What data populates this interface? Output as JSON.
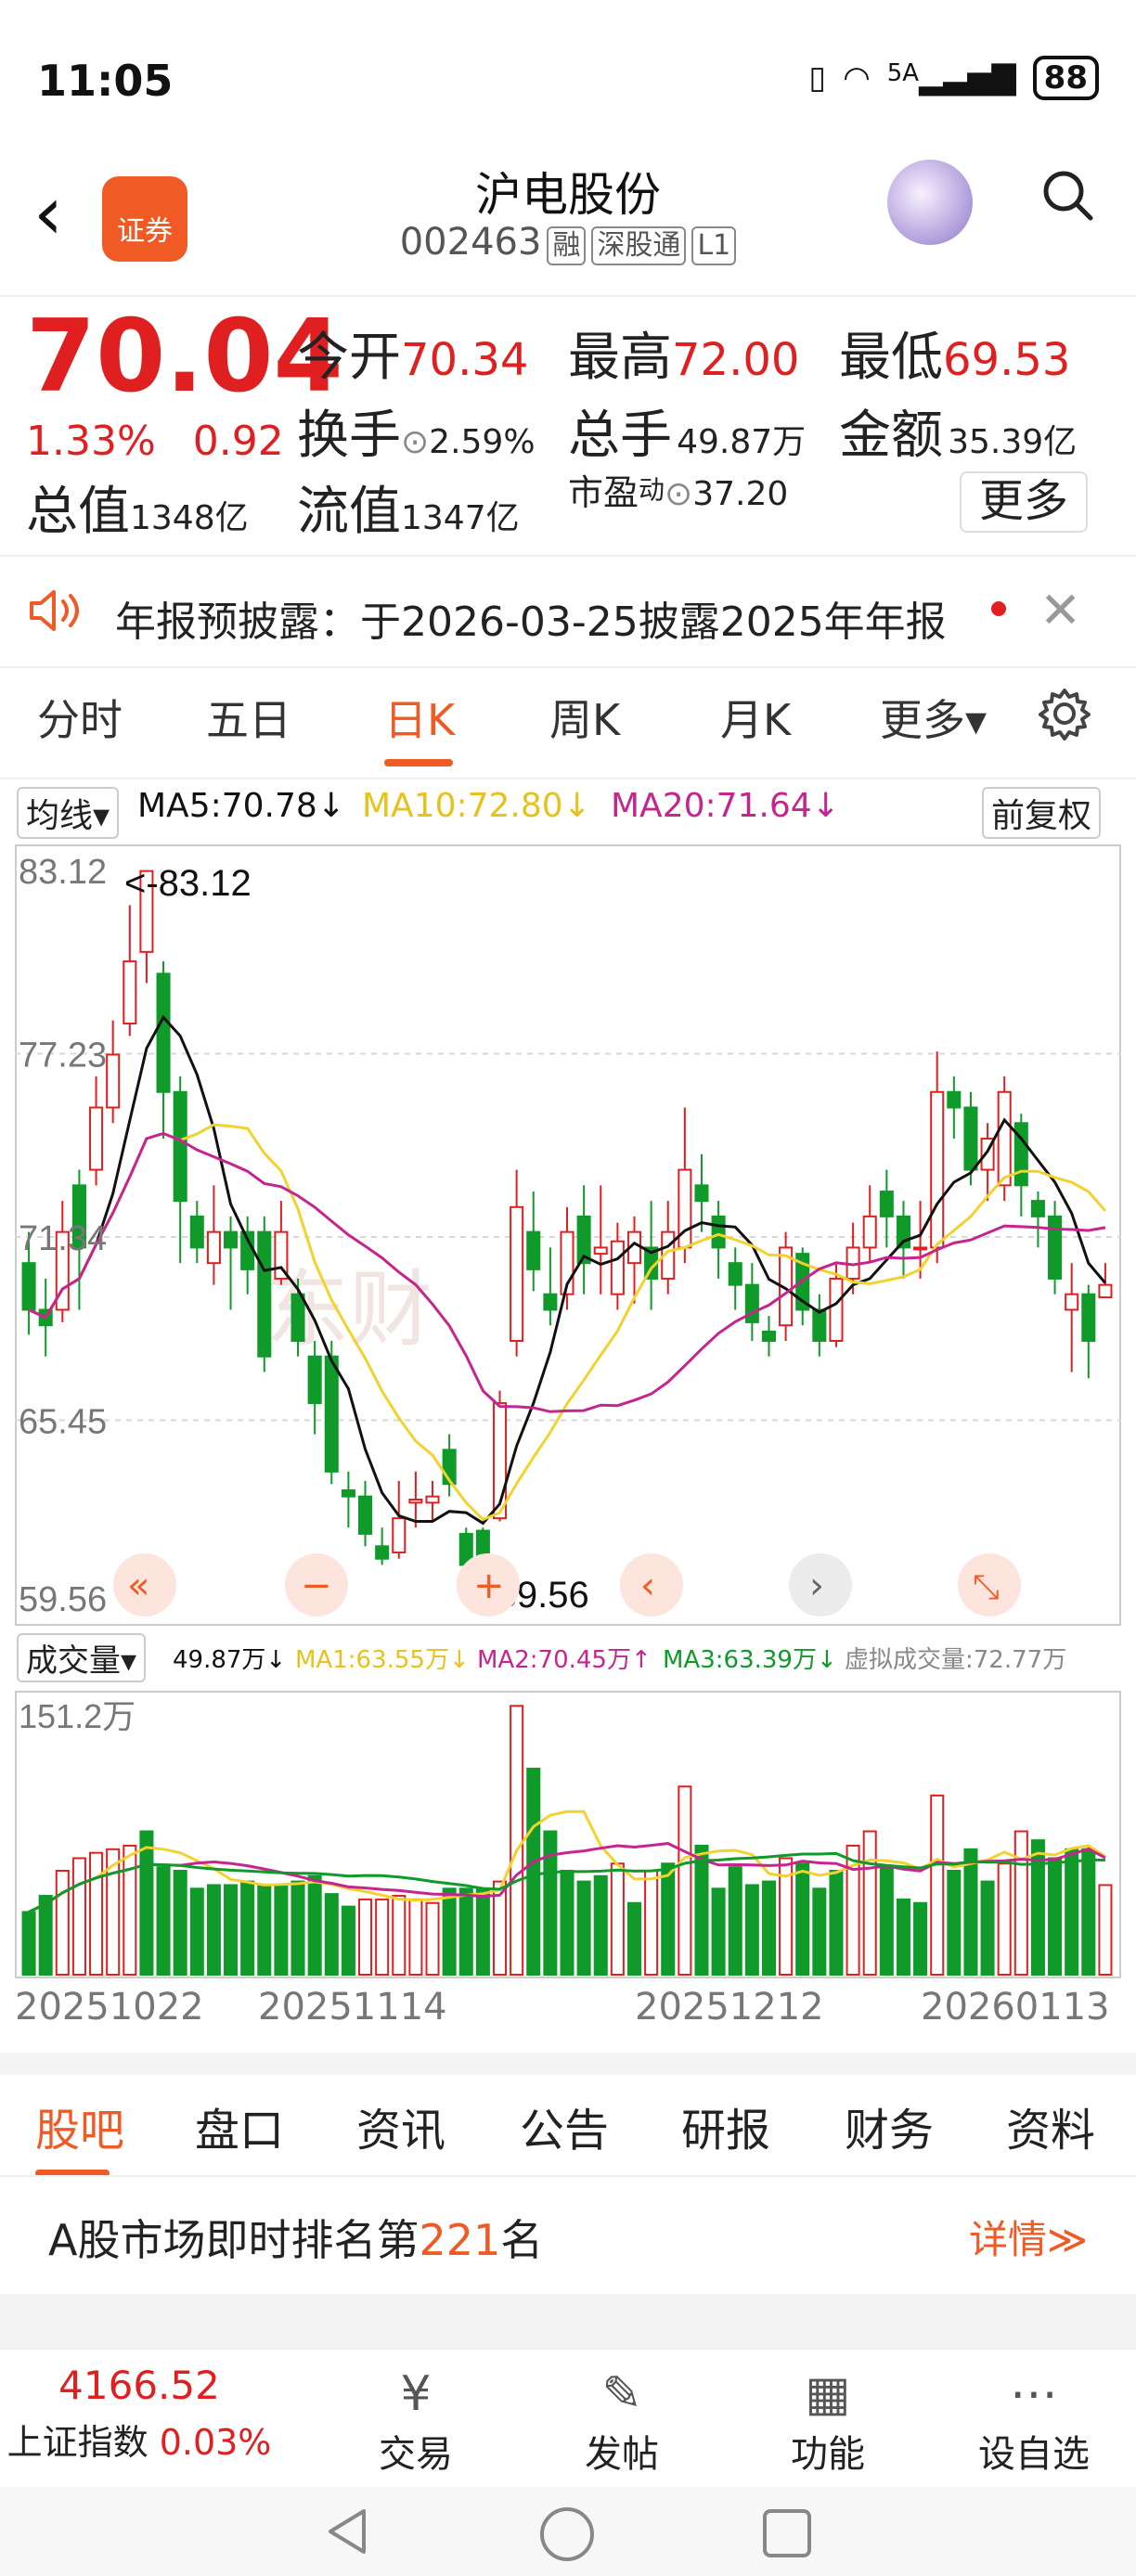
{
  "status_bar": {
    "time": "11:05",
    "network": "5A",
    "battery": "88"
  },
  "header": {
    "title": "沪电股份",
    "code": "002463",
    "tags": [
      "融",
      "深股通",
      "L1"
    ],
    "logo_text": "证券"
  },
  "quote": {
    "price": "70.04",
    "change_pct": "1.33%",
    "change": "0.92",
    "open_label": "今开",
    "open": "70.34",
    "high_label": "最高",
    "high": "72.00",
    "low_label": "最低",
    "low": "69.53",
    "turnover_label": "换手",
    "turnover": "2.59%",
    "volume_label": "总手",
    "volume": "49.87万",
    "amount_label": "金额",
    "amount": "35.39亿",
    "mktcap_label": "总值",
    "mktcap": "1348亿",
    "float_label": "流值",
    "float": "1347亿",
    "pe_label": "市盈",
    "pe_sup": "动",
    "pe": "37.20",
    "more": "更多"
  },
  "notice": {
    "text": "年报预披露：于2026-03-25披露2025年年报"
  },
  "tabs": [
    "分时",
    "五日",
    "日K",
    "周K",
    "月K",
    "更多▾"
  ],
  "ma": {
    "selector": "均线▾",
    "ma5": "MA5:70.78↓",
    "ma10": "MA10:72.80↓",
    "ma20": "MA20:71.64↓",
    "adjust": "前复权"
  },
  "vol_legend": {
    "selector": "成交量▾",
    "vol": "49.87万↓",
    "ma1": "MA1:63.55万↓",
    "ma2": "MA2:70.45万↑",
    "ma3": "MA3:63.39万↓",
    "virtual": "虚拟成交量:72.77万"
  },
  "chart_labels": {
    "max_marker": "<-83.12",
    "min_marker": "<-59.56",
    "vol_max": "151.2万"
  },
  "chart_data": {
    "type": "candlestick",
    "y_axis_ticks": [
      "83.12",
      "77.23",
      "71.34",
      "65.45",
      "59.56"
    ],
    "ylim": [
      59.56,
      83.12
    ],
    "x_tick_labels": [
      "20251022",
      "20251114",
      "20251212",
      "20260113"
    ],
    "candles": [
      [
        70.5,
        69.0,
        71.5,
        68.2
      ],
      [
        69.0,
        68.5,
        70.0,
        67.5
      ],
      [
        69.0,
        71.5,
        72.5,
        68.6
      ],
      [
        73.0,
        71.0,
        73.5,
        69.0
      ],
      [
        73.5,
        75.5,
        76.5,
        73.0
      ],
      [
        75.5,
        77.2,
        78.3,
        75.0
      ],
      [
        78.2,
        80.2,
        82.0,
        77.8
      ],
      [
        80.5,
        83.1,
        83.12,
        79.5
      ],
      [
        79.8,
        76.0,
        80.2,
        74.5
      ],
      [
        76.0,
        72.5,
        76.5,
        70.5
      ],
      [
        72.0,
        71.0,
        72.5,
        70.5
      ],
      [
        70.5,
        71.5,
        73.0,
        69.8
      ],
      [
        71.5,
        71.0,
        72.0,
        69.0
      ],
      [
        71.5,
        70.3,
        72.0,
        69.5
      ],
      [
        71.5,
        67.5,
        72.0,
        67.0
      ],
      [
        70.0,
        71.5,
        72.5,
        69.8
      ],
      [
        69.5,
        68.0,
        70.0,
        67.5
      ],
      [
        67.5,
        66.0,
        68.0,
        65.0
      ],
      [
        67.5,
        63.8,
        68.0,
        63.4
      ],
      [
        63.2,
        63.0,
        63.8,
        62.0
      ],
      [
        63.0,
        61.8,
        63.5,
        61.4
      ],
      [
        61.4,
        61.0,
        62.0,
        60.8
      ],
      [
        61.2,
        62.3,
        63.5,
        61.0
      ],
      [
        62.8,
        62.9,
        63.8,
        62.0
      ],
      [
        62.8,
        63.0,
        63.5,
        62.2
      ],
      [
        64.5,
        63.4,
        65.0,
        63.0
      ],
      [
        61.8,
        60.8,
        62.0,
        60.6
      ],
      [
        61.9,
        60.6,
        62.0,
        59.56
      ],
      [
        62.3,
        66.0,
        66.4,
        62.2
      ],
      [
        68.0,
        72.3,
        73.5,
        67.5
      ],
      [
        71.5,
        70.3,
        72.8,
        69.6
      ],
      [
        69.5,
        69.0,
        71.0,
        68.5
      ],
      [
        69.5,
        71.5,
        72.3,
        69.0
      ],
      [
        72.0,
        70.5,
        73.0,
        69.5
      ],
      [
        70.8,
        71.0,
        73.0,
        69.5
      ],
      [
        69.5,
        71.2,
        71.8,
        69.0
      ],
      [
        70.5,
        71.5,
        72.0,
        69.2
      ],
      [
        71.0,
        70.0,
        72.5,
        69.0
      ],
      [
        70.0,
        71.5,
        72.5,
        69.5
      ],
      [
        71.0,
        73.5,
        75.5,
        70.5
      ],
      [
        73.0,
        72.5,
        74.0,
        71.5
      ],
      [
        72.0,
        71.0,
        72.5,
        70.0
      ],
      [
        70.5,
        69.8,
        71.0,
        69.0
      ],
      [
        69.8,
        68.6,
        70.5,
        68.0
      ],
      [
        68.3,
        68.0,
        68.8,
        67.5
      ],
      [
        68.5,
        71.0,
        71.5,
        68.0
      ],
      [
        70.8,
        69.0,
        71.0,
        68.5
      ],
      [
        69.0,
        68.0,
        69.5,
        67.5
      ],
      [
        68.0,
        70.0,
        70.5,
        67.8
      ],
      [
        70.0,
        71.0,
        71.8,
        69.5
      ],
      [
        71.0,
        72.0,
        73.0,
        70.5
      ],
      [
        72.8,
        72.0,
        73.5,
        71.0
      ],
      [
        72.0,
        71.0,
        72.5,
        70.0
      ],
      [
        71.0,
        71.0,
        72.5,
        70.0
      ],
      [
        71.0,
        76.0,
        77.3,
        70.5
      ],
      [
        76.0,
        75.5,
        76.5,
        74.5
      ],
      [
        75.5,
        73.5,
        76.0,
        73.0
      ],
      [
        73.5,
        74.5,
        75.0,
        72.5
      ],
      [
        73.0,
        76.0,
        76.5,
        72.5
      ],
      [
        75.0,
        73.0,
        75.3,
        72.0
      ],
      [
        72.5,
        72.0,
        72.8,
        71.0
      ],
      [
        72.0,
        70.0,
        72.5,
        69.5
      ],
      [
        69.0,
        69.5,
        70.5,
        67.0
      ],
      [
        69.5,
        68.0,
        69.8,
        66.8
      ],
      [
        69.4,
        69.8,
        70.5,
        69.5
      ]
    ],
    "volume_ylim": [
      0,
      151.2
    ],
    "volumes": [
      [
        35,
        "down"
      ],
      [
        44,
        "down"
      ],
      [
        58,
        "up"
      ],
      [
        65,
        "up"
      ],
      [
        68,
        "up"
      ],
      [
        70,
        "up"
      ],
      [
        72,
        "up"
      ],
      [
        80,
        "down"
      ],
      [
        60,
        "down"
      ],
      [
        58,
        "down"
      ],
      [
        48,
        "down"
      ],
      [
        50,
        "down"
      ],
      [
        50,
        "down"
      ],
      [
        52,
        "down"
      ],
      [
        50,
        "down"
      ],
      [
        50,
        "down"
      ],
      [
        52,
        "down"
      ],
      [
        55,
        "down"
      ],
      [
        45,
        "down"
      ],
      [
        38,
        "down"
      ],
      [
        42,
        "up"
      ],
      [
        42,
        "up"
      ],
      [
        44,
        "up"
      ],
      [
        42,
        "up"
      ],
      [
        40,
        "up"
      ],
      [
        48,
        "down"
      ],
      [
        48,
        "down"
      ],
      [
        48,
        "down"
      ],
      [
        52,
        "up"
      ],
      [
        150,
        "up"
      ],
      [
        115,
        "down"
      ],
      [
        80,
        "down"
      ],
      [
        58,
        "down"
      ],
      [
        52,
        "down"
      ],
      [
        55,
        "down"
      ],
      [
        62,
        "up"
      ],
      [
        40,
        "down"
      ],
      [
        58,
        "up"
      ],
      [
        62,
        "down"
      ],
      [
        105,
        "up"
      ],
      [
        72,
        "down"
      ],
      [
        48,
        "down"
      ],
      [
        60,
        "down"
      ],
      [
        50,
        "down"
      ],
      [
        52,
        "down"
      ],
      [
        65,
        "up"
      ],
      [
        62,
        "down"
      ],
      [
        48,
        "down"
      ],
      [
        58,
        "down"
      ],
      [
        72,
        "up"
      ],
      [
        80,
        "up"
      ],
      [
        60,
        "down"
      ],
      [
        42,
        "down"
      ],
      [
        40,
        "down"
      ],
      [
        100,
        "up"
      ],
      [
        58,
        "down"
      ],
      [
        70,
        "down"
      ],
      [
        52,
        "down"
      ],
      [
        62,
        "up"
      ],
      [
        80,
        "up"
      ],
      [
        75,
        "down"
      ],
      [
        65,
        "down"
      ],
      [
        70,
        "down"
      ],
      [
        70,
        "down"
      ],
      [
        50,
        "up"
      ]
    ]
  },
  "bottom_tabs": [
    "股吧",
    "盘口",
    "资讯",
    "公告",
    "研报",
    "财务",
    "资料"
  ],
  "rank": {
    "prefix": "A股市场即时排名第",
    "number": "221",
    "suffix": "名",
    "detail": "详情≫"
  },
  "footer": {
    "index_value": "4166.52",
    "index_name": "上证指数",
    "index_change": "0.03%",
    "buttons": [
      {
        "label": "交易",
        "icon": "yen-icon"
      },
      {
        "label": "发帖",
        "icon": "edit-icon"
      },
      {
        "label": "功能",
        "icon": "grid-icon"
      },
      {
        "label": "设自选",
        "icon": "dots-icon"
      }
    ]
  },
  "colors": {
    "up": "#e02020",
    "down": "#0f9a2a",
    "accent": "#f05a24",
    "ma5": "#111111",
    "ma10": "#f2d22e",
    "ma20": "#c4258f"
  }
}
